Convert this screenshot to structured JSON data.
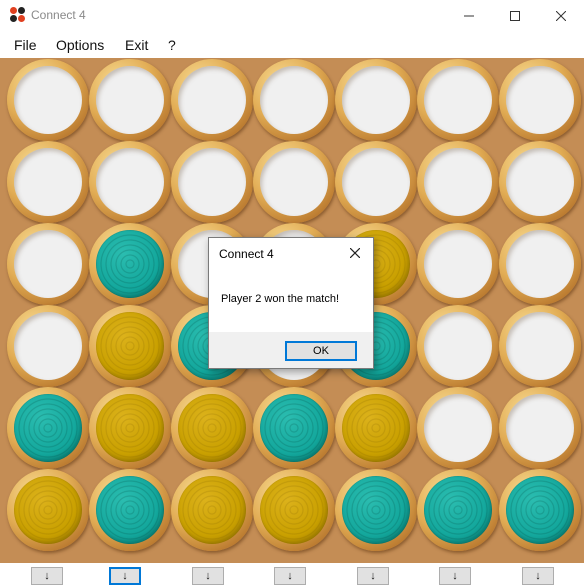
{
  "window": {
    "title": "Connect 4",
    "minimize_icon": "minimize-icon",
    "maximize_icon": "maximize-icon",
    "close_icon": "close-icon"
  },
  "menu": {
    "items": [
      "File",
      "Options",
      "Exit",
      "?"
    ]
  },
  "board": {
    "columns": 7,
    "rows": 6,
    "colors": {
      "player1": "#c9a000",
      "player2": "#13a79c",
      "empty": "#f0f0f0",
      "board": "#c48d55"
    },
    "grid": [
      [
        "empty",
        "empty",
        "empty",
        "empty",
        "empty",
        "empty",
        "empty"
      ],
      [
        "empty",
        "empty",
        "empty",
        "empty",
        "empty",
        "empty",
        "empty"
      ],
      [
        "empty",
        "teal",
        "empty",
        "empty",
        "yellow",
        "empty",
        "empty"
      ],
      [
        "empty",
        "yellow",
        "teal",
        "empty",
        "teal",
        "empty",
        "empty"
      ],
      [
        "teal",
        "yellow",
        "yellow",
        "teal",
        "yellow",
        "empty",
        "empty"
      ],
      [
        "yellow",
        "teal",
        "yellow",
        "yellow",
        "teal",
        "teal",
        "teal"
      ]
    ]
  },
  "drop_buttons": {
    "label": "↓",
    "count": 7,
    "focused_index": 1
  },
  "dialog": {
    "title": "Connect 4",
    "message": "Player 2 won the match!",
    "ok_label": "OK"
  }
}
